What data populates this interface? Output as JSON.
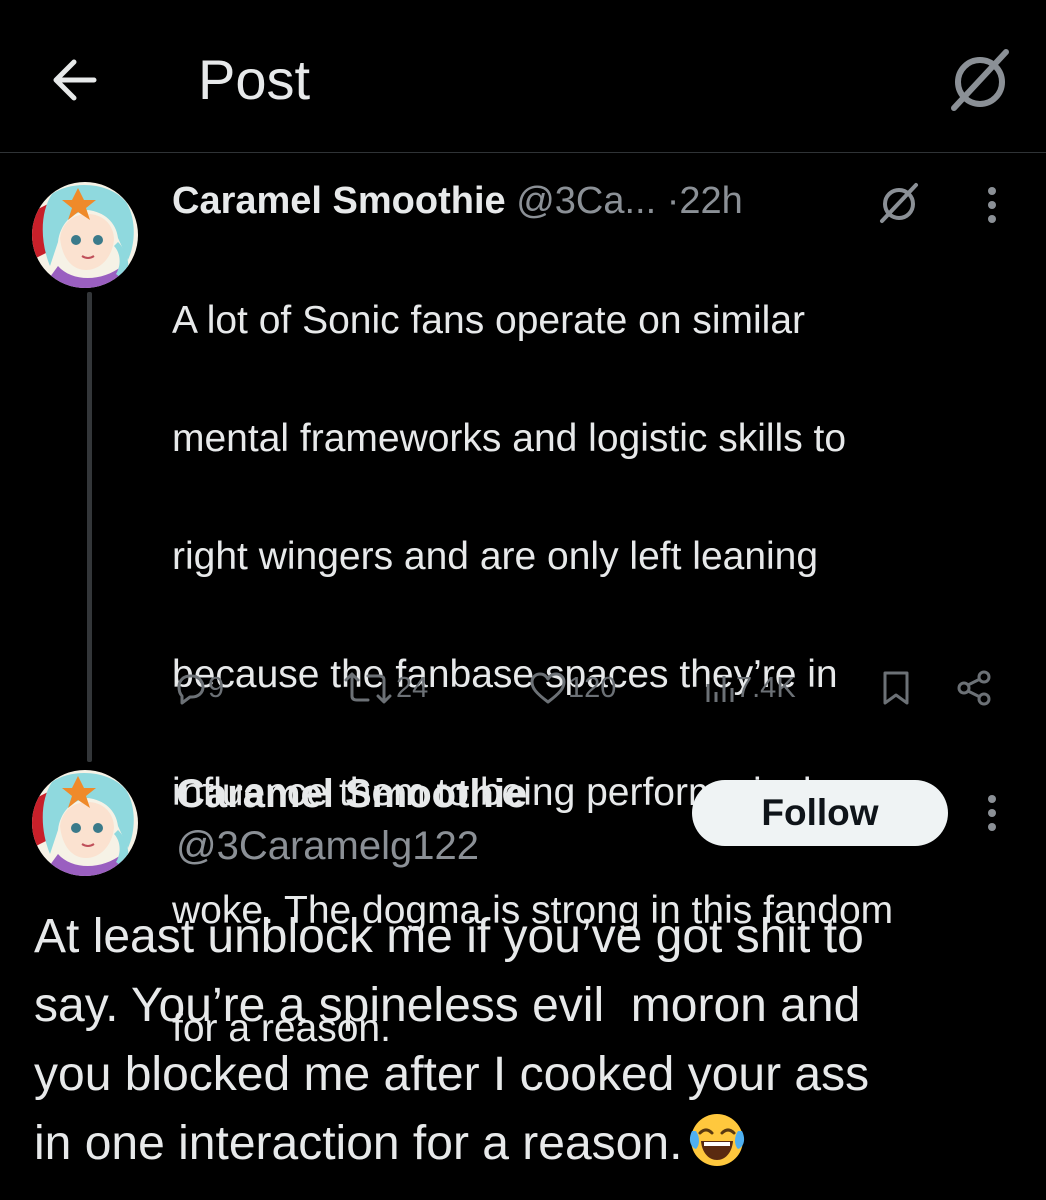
{
  "header": {
    "title": "Post",
    "back_icon": "arrow-left-icon",
    "grok_icon": "grok-icon"
  },
  "tweet1": {
    "author_name": "Caramel Smoothie",
    "author_handle": "@3Ca...",
    "separator": "·",
    "time": "22h",
    "text_lines": [
      "A lot of Sonic fans operate on similar",
      "mental frameworks and logistic skills to",
      "right wingers and are only left leaning",
      "because the fanbase spaces they’re in",
      "influence them to being performatively",
      "woke. The dogma is strong in this fandom",
      "for a reason."
    ],
    "replies": "9",
    "reposts": "24",
    "likes": "120",
    "views": "7.4K"
  },
  "tweet2": {
    "author_name": "Caramel Smoothie",
    "author_handle": "@3Caramelg122",
    "follow_label": "Follow",
    "text_lines": [
      "At least unblock me if you’ve got shit to",
      "say. You’re a spineless evil  moron and",
      "you blocked me after I cooked your ass",
      "in one interaction for a reason."
    ],
    "emoji": "face-with-tears-of-joy"
  },
  "colors": {
    "background": "#000000",
    "text_primary": "#e7e9ea",
    "text_secondary": "#8b9096",
    "action_muted": "#6c7176",
    "follow_bg": "#eff3f4",
    "divider": "#2f3336"
  }
}
